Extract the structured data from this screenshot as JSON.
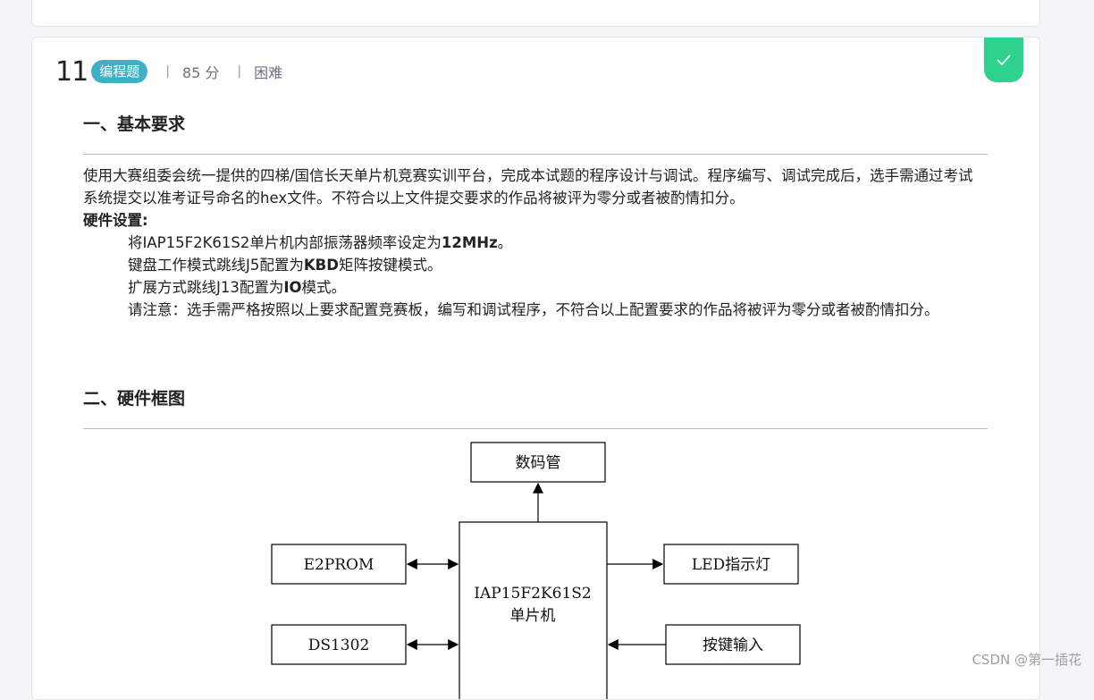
{
  "question": {
    "number": "11",
    "type_badge": "编程题",
    "score": "85 分",
    "difficulty": "困难",
    "separator": "|"
  },
  "sections": {
    "basic_title": "一、基本要求",
    "basic_para_1": "使用大赛组委会统一提供的四梯/国信长天单片机竞赛实训平台，完成本试题的程序设计与调试。程序编写、调试完成后，选手需通过考试系统提交以准考证号命名的hex文件。不符合以上文件提交要求的作品将被评为零分或者被酌情扣分。",
    "hardware_label": "硬件设置:",
    "hw_line1_pre": "将IAP15F2K61S2单片机内部振荡器频率设定为",
    "hw_line1_bold": "12MHz",
    "hw_line1_post": "。",
    "hw_line2_pre": "键盘工作模式跳线J5配置为",
    "hw_line2_bold": "KBD",
    "hw_line2_post": "矩阵按键模式。",
    "hw_line3_pre": "扩展方式跳线J13配置为",
    "hw_line3_bold": "IO",
    "hw_line3_post": "模式。",
    "hw_line4": "请注意：选手需严格按照以上要求配置竞赛板，编写和调试程序，不符合以上配置要求的作品将被评为零分或者被酌情扣分。",
    "diagram_title": "二、硬件框图"
  },
  "diagram": {
    "top": "数码管",
    "center_line1": "IAP15F2K61S2",
    "center_line2": "单片机",
    "left1": "E2PROM",
    "left2": "DS1302",
    "right1": "LED指示灯",
    "right2": "按键输入"
  },
  "watermark": "CSDN @第一插花",
  "colors": {
    "badge": "#3fb1c6",
    "check": "#2ed18d"
  },
  "icons": {
    "check": "checkmark-icon"
  }
}
